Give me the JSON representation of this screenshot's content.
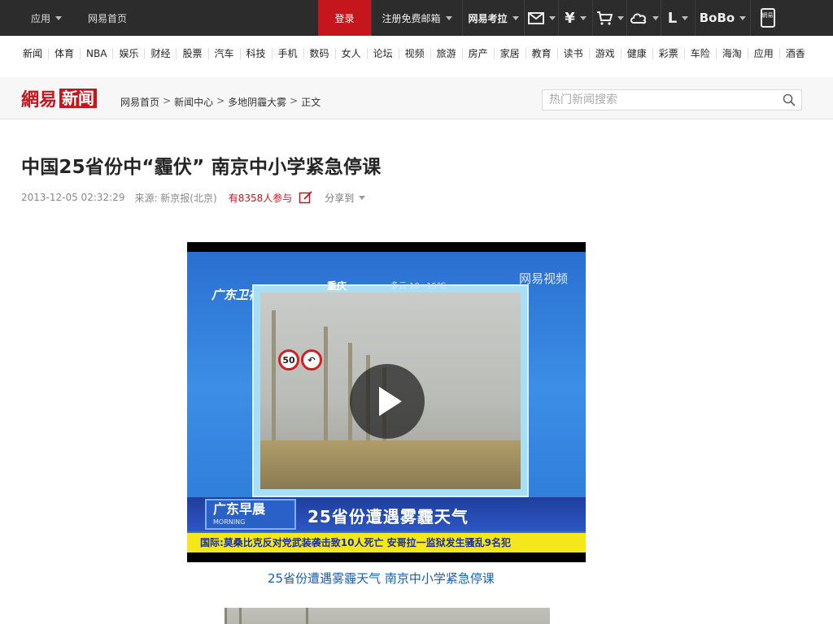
{
  "topbar": {
    "apps": "应用",
    "home": "网易首页",
    "login": "登录",
    "register": "注册免费邮箱",
    "kaola": "网易考拉",
    "bobo": "BoBo",
    "icons": [
      "mail-icon",
      "yuan-icon",
      "cart-icon",
      "cloud-icon",
      "lofter-icon",
      "bobo-icon",
      "mobile-netease-icon"
    ],
    "yuan": "¥",
    "lofter": "L",
    "mobile": "網易"
  },
  "channels": [
    "新闻",
    "体育",
    "NBA",
    "娱乐",
    "财经",
    "股票",
    "汽车",
    "科技",
    "手机",
    "数码",
    "女人",
    "论坛",
    "视频",
    "旅游",
    "房产",
    "家居",
    "教育",
    "读书",
    "游戏",
    "健康",
    "彩票",
    "车险",
    "海淘",
    "应用",
    "酒香"
  ],
  "header": {
    "logo_wy": "網易",
    "logo_xw": "新闻",
    "breadcrumb": [
      "网易首页",
      "新闻中心",
      "多地阴霾大雾",
      "正文"
    ],
    "search_placeholder": "热门新闻搜索"
  },
  "article": {
    "title": "中国25省份中“霾伏” 南京中小学紧急停课",
    "time": "2013-12-05 02:32:29",
    "source": "来源: 新京报(北京)",
    "participants": "有8358人参与",
    "share": "分享到"
  },
  "video": {
    "watermark": "网易视频",
    "channel": "广东卫视",
    "city": "重庆",
    "weather": "多云 10~15℃",
    "show": "广东早晨",
    "show_en": "MORNING",
    "headline": "25省份遭遇雾霾天气",
    "ticker": "国际:莫桑比克反对党武装袭击致10人死亡   安哥拉一监狱发生骚乱9名犯",
    "sign1": "50",
    "caption": "25省份遭遇雾霾天气 南京中小学紧急停课"
  },
  "colors": {
    "brand_red": "#c4161c",
    "topbar": "#2c2c2c",
    "link": "#1a5fb0"
  }
}
